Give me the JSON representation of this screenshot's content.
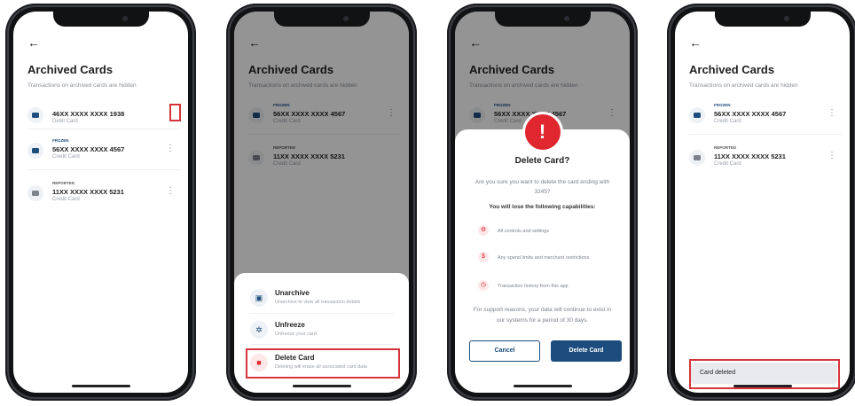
{
  "screens": [
    {
      "title": "Archived Cards",
      "subtitle": "Transactions on archived cards are hidden",
      "cards": [
        {
          "label": "",
          "number": "46XX XXXX XXXX 1938",
          "type": "Debit Card"
        },
        {
          "label": "FROZEN",
          "number": "56XX XXXX XXXX 4567",
          "type": "Credit Card"
        },
        {
          "label": "REPORTED",
          "number": "11XX XXXX XXXX 5231",
          "type": "Credit Card"
        }
      ]
    },
    {
      "title": "Archived Cards",
      "subtitle": "Transactions on archived cards are hidden",
      "cards": [
        {
          "label": "FROZEN",
          "number": "56XX XXXX XXXX 4567",
          "type": "Credit Card"
        },
        {
          "label": "REPORTED",
          "number": "11XX XXXX XXXX 5231",
          "type": "Credit Card"
        }
      ],
      "sheet": [
        {
          "title": "Unarchive",
          "desc": "Unarchive to view all transaction details",
          "icon": "archive-icon"
        },
        {
          "title": "Unfreeze",
          "desc": "Unfreeze your card",
          "icon": "snowflake-icon"
        },
        {
          "title": "Delete Card",
          "desc": "Deleting will erase all associated card data",
          "icon": "trash-icon"
        }
      ]
    },
    {
      "title": "Archived Cards",
      "subtitle": "Transactions on archived cards are hidden",
      "cards": [
        {
          "label": "FROZEN",
          "number": "56XX XXXX XXXX 4567",
          "type": "Credit Card"
        }
      ],
      "modal": {
        "alert": "!",
        "title": "Delete Card?",
        "body": "Are you sure you want to delete the card ending with 3245?",
        "caps_heading": "You will lose the following capabilities:",
        "capabilities": [
          {
            "icon": "controls-icon",
            "text": "All controls and settings"
          },
          {
            "icon": "dollar-icon",
            "text": "Any spend limits and merchant restrictions"
          },
          {
            "icon": "history-icon",
            "text": "Transaction history from this app"
          }
        ],
        "footer": "For support reasons, your data will continue to exist in our systems for a period of 30 days.",
        "cancel": "Cancel",
        "delete": "Delete Card"
      }
    },
    {
      "title": "Archived Cards",
      "subtitle": "Transactions on archived cards are hidden",
      "cards": [
        {
          "label": "FROZEN",
          "number": "56XX XXXX XXXX 4567",
          "type": "Credit Card"
        },
        {
          "label": "REPORTED",
          "number": "11XX XXXX XXXX 5231",
          "type": "Credit Card"
        }
      ],
      "toast": "Card deleted"
    }
  ],
  "glyphs": {
    "back": "←",
    "more": "⋮"
  },
  "colors": {
    "primary": "#1d4d7e",
    "danger": "#e0262e",
    "highlight": "#d5343b"
  }
}
